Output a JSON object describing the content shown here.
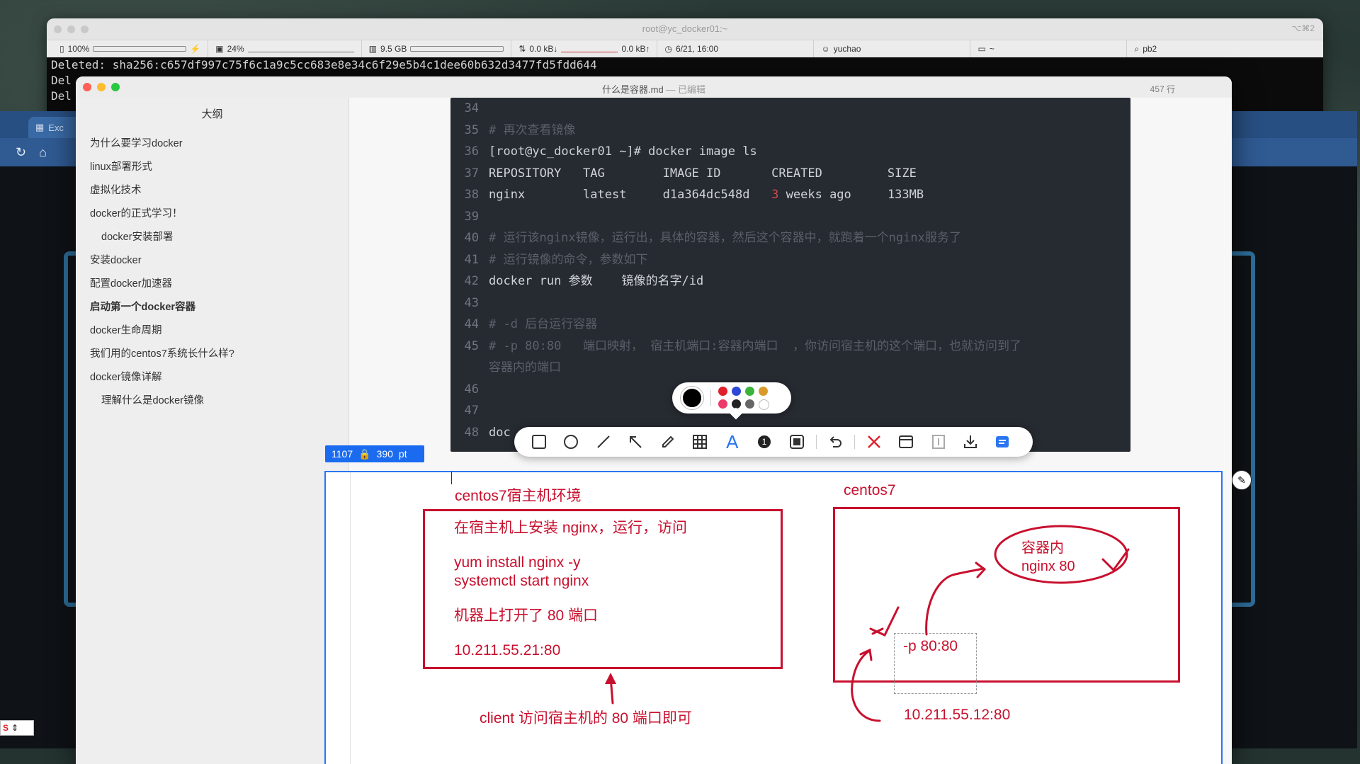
{
  "terminal": {
    "title": "root@yc_docker01:~",
    "shortcut": "⌥⌘2",
    "status": {
      "battery": "100%",
      "cpu": "24%",
      "memory": "9.5 GB",
      "net_down": "0.0 kB↓",
      "net_up": "0.0 kB↑",
      "datetime": "6/21, 16:00",
      "user": "yuchao",
      "folder": "~",
      "search": "pb2"
    },
    "lines": [
      "Deleted: sha256:c657df997c75f6c1a9c5cc683e8e34c6f29e5b4c1dee60b632d3477fd5fdd644",
      "Del",
      "Del"
    ]
  },
  "chrome": {
    "tab_label": "Exc"
  },
  "typora": {
    "title": "什么是容器.md",
    "title_suffix": "— 已编辑",
    "line_count": "457 行",
    "outline_title": "大纲",
    "outline": [
      {
        "label": "为什么要学习docker",
        "level": 1,
        "active": false
      },
      {
        "label": "linux部署形式",
        "level": 1,
        "active": false
      },
      {
        "label": "虚拟化技术",
        "level": 1,
        "active": false
      },
      {
        "label": "docker的正式学习！",
        "level": 1,
        "active": false
      },
      {
        "label": "docker安装部署",
        "level": 2,
        "active": false
      },
      {
        "label": "安装docker",
        "level": 1,
        "active": false
      },
      {
        "label": "配置docker加速器",
        "level": 1,
        "active": false
      },
      {
        "label": "启动第一个docker容器",
        "level": 1,
        "active": true
      },
      {
        "label": "docker生命周期",
        "level": 1,
        "active": false
      },
      {
        "label": "我们用的centos7系统长什么样?",
        "level": 1,
        "active": false
      },
      {
        "label": "docker镜像详解",
        "level": 1,
        "active": false
      },
      {
        "label": "理解什么是docker镜像",
        "level": 2,
        "active": false
      }
    ],
    "code_lines": [
      {
        "n": "34",
        "t": ""
      },
      {
        "n": "35",
        "t": "# 再次查看镜像",
        "c": true
      },
      {
        "n": "36",
        "t": "[root@yc_docker01 ~]# docker image ls"
      },
      {
        "n": "37",
        "t": "REPOSITORY   TAG        IMAGE ID       CREATED         SIZE"
      },
      {
        "n": "38",
        "t": "nginx        latest     d1a364dc548d   3 weeks ago     133MB"
      },
      {
        "n": "39",
        "t": ""
      },
      {
        "n": "40",
        "t": "# 运行该nginx镜像，运行出，具体的容器，然后这个容器中，就跑着一个nginx服务了",
        "c": true
      },
      {
        "n": "41",
        "t": "# 运行镜像的命令，参数如下",
        "c": true
      },
      {
        "n": "42",
        "t": "docker run 参数    镜像的名字/id"
      },
      {
        "n": "43",
        "t": ""
      },
      {
        "n": "44",
        "t": "# -d 后台运行容器",
        "c": true
      },
      {
        "n": "45",
        "t": "# -p 80:80   端口映射， 宿主机端口:容器内端口  ，你访问宿主机的这个端口，也就访问到了",
        "c": true
      },
      {
        "n": "",
        "t": "容器内的端口",
        "c": true
      },
      {
        "n": "46",
        "t": ""
      },
      {
        "n": "47",
        "t": ""
      },
      {
        "n": "48",
        "t": "doc"
      }
    ]
  },
  "snip": {
    "width": "1107",
    "height": "390",
    "unit": "pt",
    "colors": [
      "#e0202a",
      "#2b49d6",
      "#3cb43c",
      "#d99a2b",
      "#ec3a6a",
      "#222222",
      "#666666",
      "#ffffff"
    ],
    "selected_color": "#000000",
    "tools": [
      "rectangle-icon",
      "circle-icon",
      "line-icon",
      "arrow-icon",
      "pencil-icon",
      "mosaic-icon",
      "text-icon",
      "number-icon",
      "border-icon",
      "undo-icon",
      "cancel-icon",
      "window-icon",
      "pin-to-screen-icon",
      "download-icon",
      "copy-icon"
    ]
  },
  "diagram": {
    "left_title": "centos7宿主机环境",
    "box_line1": "在宿主机上安装 nginx，运行，访问",
    "box_line2": "yum install nginx -y",
    "box_line3": "systemctl start nginx",
    "box_line4": "机器上打开了 80 端口",
    "box_line5": "10.211.55.21:80",
    "client_note": "client 访问宿主机的 80 端口即可",
    "right_title": "centos7",
    "container_line1": "容器内",
    "container_line2": "nginx 80",
    "port_map": "-p 80:80",
    "right_ip": "10.211.55.12:80"
  }
}
